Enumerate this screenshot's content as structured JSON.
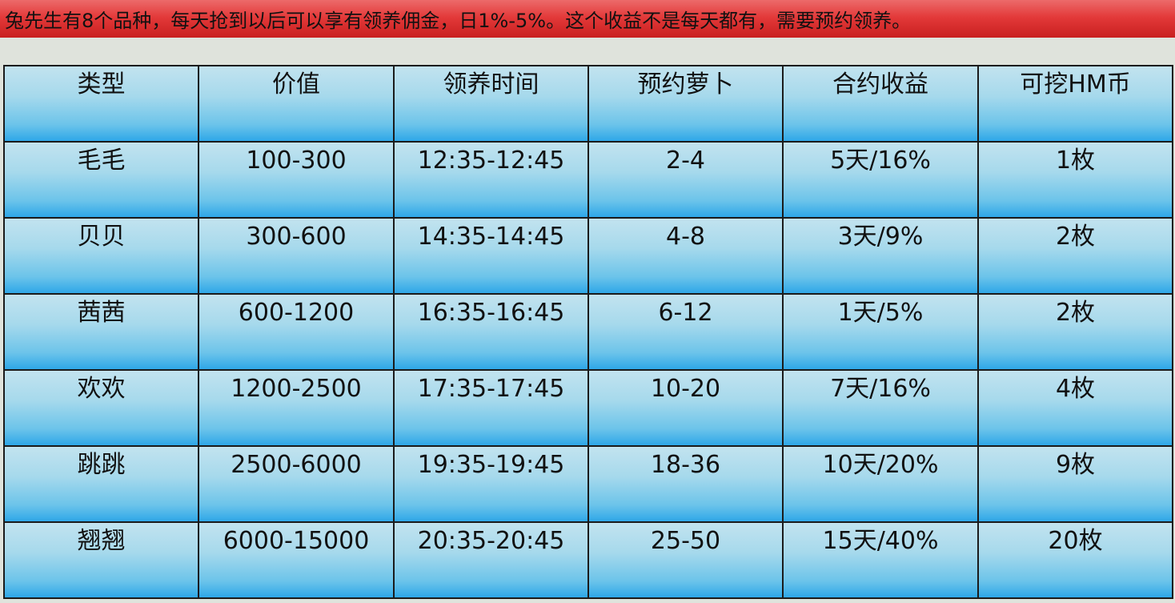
{
  "banner": {
    "text": "兔先生有8个品种，每天抢到以后可以享有领养佣金，日1%-5%。这个收益不是每天都有，需要预约领养。"
  },
  "table": {
    "headers": [
      "类型",
      "价值",
      "领养时间",
      "预约萝卜",
      "合约收益",
      "可挖HM币"
    ],
    "rows": [
      [
        "毛毛",
        "100-300",
        "12:35-12:45",
        "2-4",
        "5天/16%",
        "1枚"
      ],
      [
        "贝贝",
        "300-600",
        "14:35-14:45",
        "4-8",
        "3天/9%",
        "2枚"
      ],
      [
        "茜茜",
        "600-1200",
        "16:35-16:45",
        "6-12",
        "1天/5%",
        "2枚"
      ],
      [
        "欢欢",
        "1200-2500",
        "17:35-17:45",
        "10-20",
        "7天/16%",
        "4枚"
      ],
      [
        "跳跳",
        "2500-6000",
        "19:35-19:45",
        "18-36",
        "10天/20%",
        "9枚"
      ],
      [
        "翘翘",
        "6000-15000",
        "20:35-20:45",
        "25-50",
        "15天/40%",
        "20枚"
      ]
    ]
  },
  "colors": {
    "banner_red": "#e33a3a",
    "cell_top": "#c2e3ef",
    "cell_bottom": "#2ea7e8",
    "border": "#1b1b1b",
    "page_bg": "#dfe3dc"
  }
}
